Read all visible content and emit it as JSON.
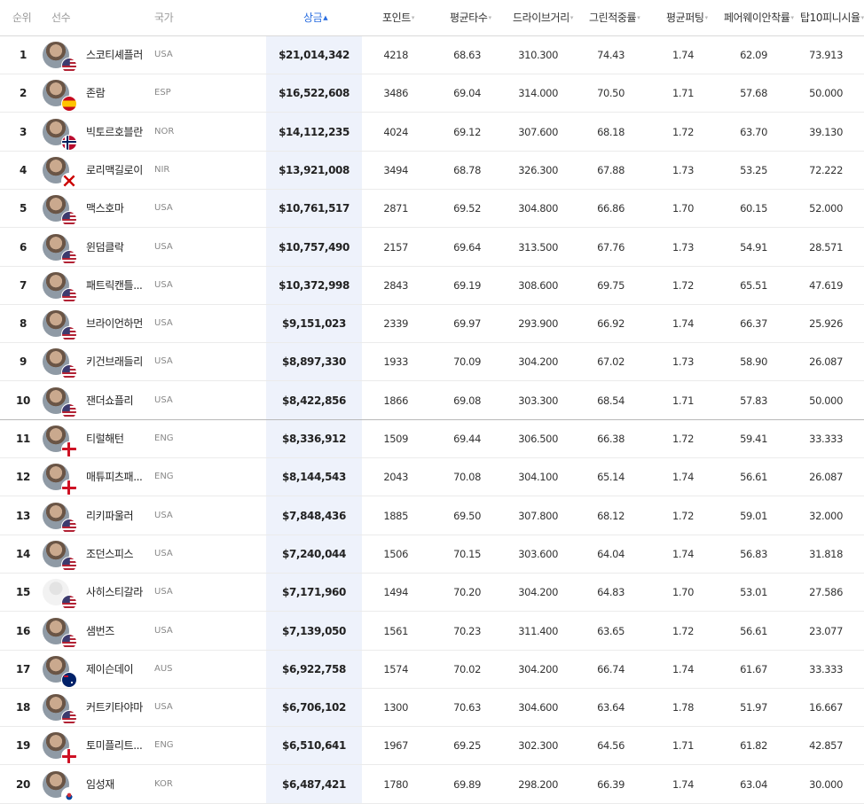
{
  "header": {
    "rank": "순위",
    "player": "선수",
    "country": "국가",
    "prize": "상금",
    "points": "포인트",
    "avg_score": "평균타수",
    "drive_dist": "드라이브거리",
    "gir": "그린적중률",
    "avg_putt": "평균퍼팅",
    "fairway": "페어웨이안착률",
    "top10": "탑10피니시율",
    "sort_arrow": "▾",
    "active_sort_arrow": "▲"
  },
  "colors": {
    "accent": "#2a6ee0",
    "highlight_column": "#eef2fb"
  },
  "rows": [
    {
      "rank": "1",
      "name": "스코티셰플러",
      "country": "USA",
      "prize": "$21,014,342",
      "points": "4218",
      "avg_score": "68.63",
      "drive_dist": "310.300",
      "gir": "74.43",
      "avg_putt": "1.74",
      "fairway": "62.09",
      "top10": "73.913",
      "flag": "usa-flag-icon"
    },
    {
      "rank": "2",
      "name": "존람",
      "country": "ESP",
      "prize": "$16,522,608",
      "points": "3486",
      "avg_score": "69.04",
      "drive_dist": "314.000",
      "gir": "70.50",
      "avg_putt": "1.71",
      "fairway": "57.68",
      "top10": "50.000",
      "flag": "spain-flag-icon"
    },
    {
      "rank": "3",
      "name": "빅토르호블란",
      "country": "NOR",
      "prize": "$14,112,235",
      "points": "4024",
      "avg_score": "69.12",
      "drive_dist": "307.600",
      "gir": "68.18",
      "avg_putt": "1.72",
      "fairway": "63.70",
      "top10": "39.130",
      "flag": "norway-flag-icon"
    },
    {
      "rank": "4",
      "name": "로리맥길로이",
      "country": "NIR",
      "prize": "$13,921,008",
      "points": "3494",
      "avg_score": "68.78",
      "drive_dist": "326.300",
      "gir": "67.88",
      "avg_putt": "1.73",
      "fairway": "53.25",
      "top10": "72.222",
      "flag": "northern-ireland-flag-icon"
    },
    {
      "rank": "5",
      "name": "맥스호마",
      "country": "USA",
      "prize": "$10,761,517",
      "points": "2871",
      "avg_score": "69.52",
      "drive_dist": "304.800",
      "gir": "66.86",
      "avg_putt": "1.70",
      "fairway": "60.15",
      "top10": "52.000",
      "flag": "usa-flag-icon"
    },
    {
      "rank": "6",
      "name": "윈덤클락",
      "country": "USA",
      "prize": "$10,757,490",
      "points": "2157",
      "avg_score": "69.64",
      "drive_dist": "313.500",
      "gir": "67.76",
      "avg_putt": "1.73",
      "fairway": "54.91",
      "top10": "28.571",
      "flag": "usa-flag-icon"
    },
    {
      "rank": "7",
      "name": "패트릭캔틀...",
      "country": "USA",
      "prize": "$10,372,998",
      "points": "2843",
      "avg_score": "69.19",
      "drive_dist": "308.600",
      "gir": "69.75",
      "avg_putt": "1.72",
      "fairway": "65.51",
      "top10": "47.619",
      "flag": "usa-flag-icon"
    },
    {
      "rank": "8",
      "name": "브라이언하먼",
      "country": "USA",
      "prize": "$9,151,023",
      "points": "2339",
      "avg_score": "69.97",
      "drive_dist": "293.900",
      "gir": "66.92",
      "avg_putt": "1.74",
      "fairway": "66.37",
      "top10": "25.926",
      "flag": "usa-flag-icon"
    },
    {
      "rank": "9",
      "name": "키건브래들리",
      "country": "USA",
      "prize": "$8,897,330",
      "points": "1933",
      "avg_score": "70.09",
      "drive_dist": "304.200",
      "gir": "67.02",
      "avg_putt": "1.73",
      "fairway": "58.90",
      "top10": "26.087",
      "flag": "usa-flag-icon"
    },
    {
      "rank": "10",
      "name": "잰더쇼플리",
      "country": "USA",
      "prize": "$8,422,856",
      "points": "1866",
      "avg_score": "69.08",
      "drive_dist": "303.300",
      "gir": "68.54",
      "avg_putt": "1.71",
      "fairway": "57.83",
      "top10": "50.000",
      "flag": "usa-flag-icon"
    },
    {
      "rank": "11",
      "name": "티럴해턴",
      "country": "ENG",
      "prize": "$8,336,912",
      "points": "1509",
      "avg_score": "69.44",
      "drive_dist": "306.500",
      "gir": "66.38",
      "avg_putt": "1.72",
      "fairway": "59.41",
      "top10": "33.333",
      "flag": "england-flag-icon"
    },
    {
      "rank": "12",
      "name": "매튜피츠패...",
      "country": "ENG",
      "prize": "$8,144,543",
      "points": "2043",
      "avg_score": "70.08",
      "drive_dist": "304.100",
      "gir": "65.14",
      "avg_putt": "1.74",
      "fairway": "56.61",
      "top10": "26.087",
      "flag": "england-flag-icon"
    },
    {
      "rank": "13",
      "name": "리키파울러",
      "country": "USA",
      "prize": "$7,848,436",
      "points": "1885",
      "avg_score": "69.50",
      "drive_dist": "307.800",
      "gir": "68.12",
      "avg_putt": "1.72",
      "fairway": "59.01",
      "top10": "32.000",
      "flag": "usa-flag-icon"
    },
    {
      "rank": "14",
      "name": "조던스피스",
      "country": "USA",
      "prize": "$7,240,044",
      "points": "1506",
      "avg_score": "70.15",
      "drive_dist": "303.600",
      "gir": "64.04",
      "avg_putt": "1.74",
      "fairway": "56.83",
      "top10": "31.818",
      "flag": "usa-flag-icon"
    },
    {
      "rank": "15",
      "name": "사히스티갈라",
      "country": "USA",
      "prize": "$7,171,960",
      "points": "1494",
      "avg_score": "70.20",
      "drive_dist": "304.200",
      "gir": "64.83",
      "avg_putt": "1.70",
      "fairway": "53.01",
      "top10": "27.586",
      "flag": "usa-flag-icon",
      "blank": true
    },
    {
      "rank": "16",
      "name": "샘번즈",
      "country": "USA",
      "prize": "$7,139,050",
      "points": "1561",
      "avg_score": "70.23",
      "drive_dist": "311.400",
      "gir": "63.65",
      "avg_putt": "1.72",
      "fairway": "56.61",
      "top10": "23.077",
      "flag": "usa-flag-icon"
    },
    {
      "rank": "17",
      "name": "제이슨데이",
      "country": "AUS",
      "prize": "$6,922,758",
      "points": "1574",
      "avg_score": "70.02",
      "drive_dist": "304.200",
      "gir": "66.74",
      "avg_putt": "1.74",
      "fairway": "61.67",
      "top10": "33.333",
      "flag": "australia-flag-icon"
    },
    {
      "rank": "18",
      "name": "커트키타야마",
      "country": "USA",
      "prize": "$6,706,102",
      "points": "1300",
      "avg_score": "70.63",
      "drive_dist": "304.600",
      "gir": "63.64",
      "avg_putt": "1.78",
      "fairway": "51.97",
      "top10": "16.667",
      "flag": "usa-flag-icon"
    },
    {
      "rank": "19",
      "name": "토미플리트...",
      "country": "ENG",
      "prize": "$6,510,641",
      "points": "1967",
      "avg_score": "69.25",
      "drive_dist": "302.300",
      "gir": "64.56",
      "avg_putt": "1.71",
      "fairway": "61.82",
      "top10": "42.857",
      "flag": "england-flag-icon"
    },
    {
      "rank": "20",
      "name": "임성재",
      "country": "KOR",
      "prize": "$6,487,421",
      "points": "1780",
      "avg_score": "69.89",
      "drive_dist": "298.200",
      "gir": "66.39",
      "avg_putt": "1.74",
      "fairway": "63.04",
      "top10": "30.000",
      "flag": "south-korea-flag-icon"
    }
  ]
}
